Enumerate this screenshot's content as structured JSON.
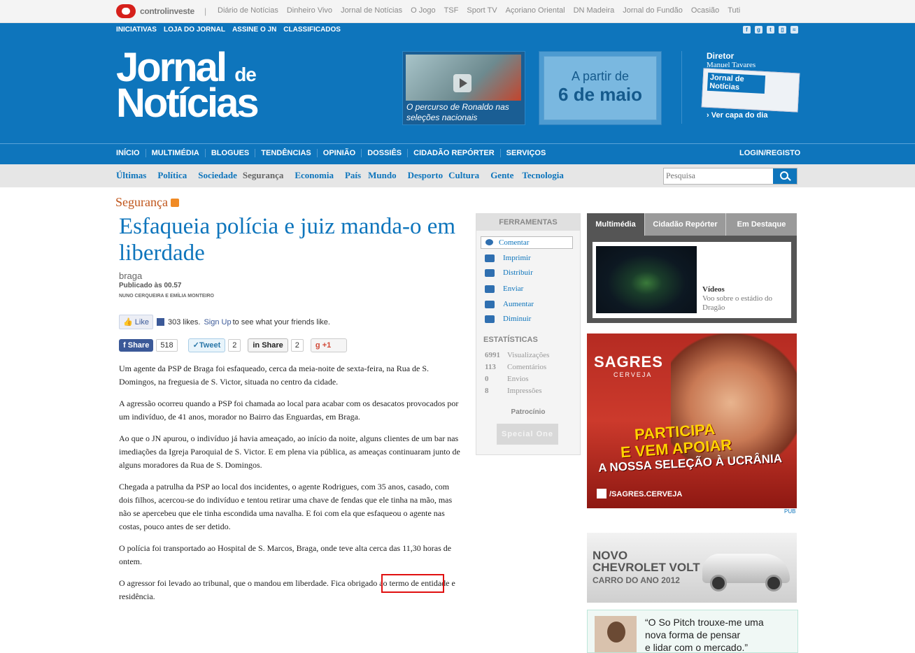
{
  "network": {
    "logo": "controlinveste",
    "separator": "|",
    "links": [
      "Diário de Notícias",
      "Dinheiro Vivo",
      "Jornal de Notícias",
      "O Jogo",
      "TSF",
      "Sport TV",
      "Açoriano Oriental",
      "DN Madeira",
      "Jornal do Fundão",
      "Ocasião",
      "Tuti"
    ]
  },
  "header": {
    "toplinks": [
      "INICIATIVAS",
      "LOJA DO JORNAL",
      "ASSINE O JN",
      "CLASSIFICADOS"
    ],
    "social_icons": [
      "facebook-icon",
      "google-plus-icon",
      "twitter-icon",
      "mobile-icon",
      "rss-icon"
    ],
    "brand": {
      "line1": "Jornal",
      "line1_small": "de",
      "line2": "Notícias"
    },
    "promo_video": {
      "caption": "O percurso de Ronaldo nas seleções nacionais"
    },
    "promo_date": {
      "line1": "A partir de",
      "line2": "6 de maio"
    },
    "director": {
      "label": "Diretor",
      "name": "Manuel Tavares",
      "paper_title": "Jornal de Notícias",
      "cover_link": "Ver capa do dia"
    }
  },
  "mainnav": {
    "items": [
      "INÍCIO",
      "MULTIMÉDIA",
      "BLOGUES",
      "TENDÊNCIAS",
      "OPINIÃO",
      "DOSSIÊS",
      "CIDADÃO REPÓRTER",
      "SERVIÇOS"
    ],
    "login": "LOGIN/REGISTO"
  },
  "secnav": {
    "items": [
      "Últimas",
      "Política",
      "Sociedade",
      "Segurança",
      "Economia",
      "País",
      "Mundo",
      "Desporto",
      "Cultura",
      "Gente",
      "Tecnologia"
    ],
    "active_index": 3,
    "search_placeholder": "Pesquisa"
  },
  "article": {
    "section": "Segurança",
    "headline": "Esfaqueia polícia e juiz manda-o em liberdade",
    "kicker": "braga",
    "published": "Publicado às 00.57",
    "authors": "NUNO CERQUEIRA E EMÍLIA MONTEIRO",
    "fb": {
      "like": "Like",
      "count_text": "303 likes.",
      "signup": "Sign Up",
      "rest": "to see what your friends like."
    },
    "share": {
      "fb_label": "Share",
      "fb_count": "518",
      "tw_label": "Tweet",
      "tw_count": "2",
      "in_label": "Share",
      "in_count": "2",
      "gp_label": "+1"
    },
    "paragraphs": [
      "Um agente da PSP de Braga foi esfaqueado, cerca da meia-noite de sexta-feira, na Rua de S. Domingos, na freguesia de S. Victor, situada no centro da cidade.",
      "A agressão ocorreu quando a PSP foi chamada ao local para acabar com os desacatos provocados por um indivíduo, de 41 anos, morador no Bairro das Enguardas, em Braga.",
      "Ao que o JN apurou, o indivíduo já havia ameaçado, ao início da noite, alguns clientes de um bar nas imediações da Igreja Paroquial de S. Victor. E em plena via pública, as ameaças continuaram junto de alguns moradores da Rua de S. Domingos.",
      "Chegada a patrulha da PSP ao local dos incidentes, o agente Rodrigues, com 35 anos, casado, com dois filhos, acercou-se do indivíduo e tentou retirar uma chave de fendas que ele tinha na mão, mas não se apercebeu que ele tinha escondida uma navalha. E foi com ela que esfaqueou o agente nas costas, pouco antes de ser detido.",
      "O polícia foi transportado ao Hospital de S. Marcos, Braga, onde teve alta cerca das 11,30 horas de ontem.",
      "O agressor foi levado ao tribunal, que o mandou em liberdade. Fica obrigado ao termo de entidade e residência."
    ]
  },
  "tools": {
    "header": "FERRAMENTAS",
    "comment": "Comentar",
    "items": [
      "Imprimir",
      "Distribuir",
      "Enviar",
      "Aumentar",
      "Diminuir"
    ],
    "stats_header": "ESTATÍSTICAS",
    "stats": [
      {
        "value": "6991",
        "label": "Visualizações"
      },
      {
        "value": "113",
        "label": "Comentários"
      },
      {
        "value": "0",
        "label": "Envios"
      },
      {
        "value": "8",
        "label": "Impressões"
      }
    ],
    "sponsor_label": "Patrocínio",
    "sponsor": "Special One"
  },
  "multimedia": {
    "tabs": [
      "Multimédia",
      "Cidadão Repórter",
      "Em Destaque"
    ],
    "active_tab": 0,
    "item_type": "Vídeos",
    "item_caption": "Voo sobre o estádio do Dragão"
  },
  "ads": {
    "sagres": {
      "brand": "SAGRES",
      "sub": "CERVEJA",
      "l1": "PARTICIPA",
      "l2": "E VEM APOIAR",
      "l3": "A NOSSA SELEÇÃO À UCRÂNIA",
      "fb": "/SAGRES.CERVEJA"
    },
    "pub": "PUB",
    "chevrolet": {
      "l1": "NOVO",
      "l2": "CHEVROLET VOLT",
      "l3": "CARRO DO ANO 2012"
    },
    "quote": {
      "l1": "“O So Pitch trouxe-me  uma",
      "l2": "nova forma de pensar",
      "l3": "e lidar com o mercado.”"
    }
  }
}
